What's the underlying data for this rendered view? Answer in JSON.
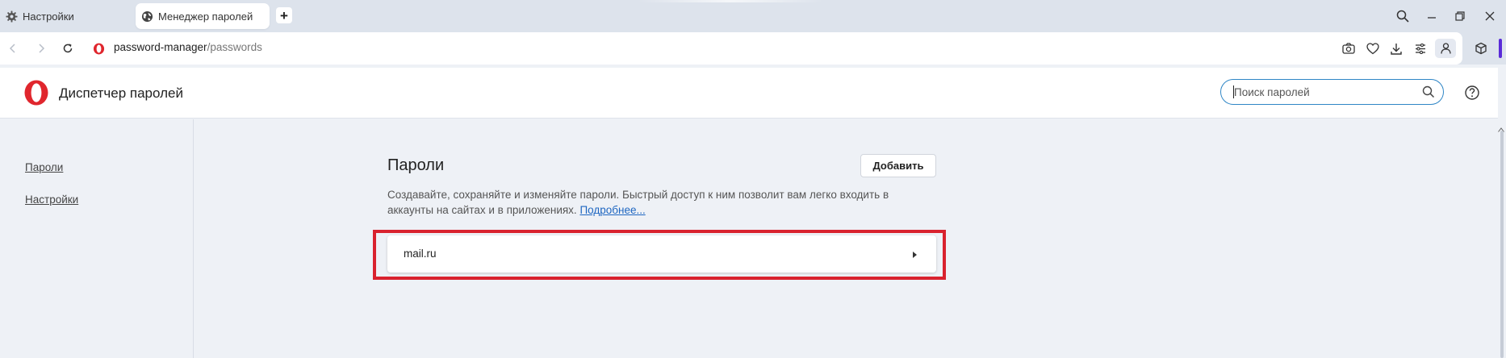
{
  "tabs": [
    {
      "label": "Настройки",
      "icon": "gear-icon",
      "active": false
    },
    {
      "label": "Менеджер паролей",
      "icon": "globe-icon",
      "active": true
    }
  ],
  "window_controls": [
    "search-tabs-icon",
    "minimize-icon",
    "restore-icon",
    "close-icon"
  ],
  "address_bar": {
    "host": "password-manager",
    "path": "/passwords"
  },
  "toolbar_icons": [
    "camera-icon",
    "heart-icon",
    "download-icon",
    "easy-setup-icon",
    "profile-icon",
    "extensions-icon"
  ],
  "header": {
    "title": "Диспетчер паролей",
    "search_placeholder": "Поиск паролей"
  },
  "sidebar": {
    "items": [
      {
        "label": "Пароли"
      },
      {
        "label": "Настройки"
      }
    ]
  },
  "main": {
    "title": "Пароли",
    "add_label": "Добавить",
    "description": "Создавайте, сохраняйте и изменяйте пароли. Быстрый доступ к ним позволит вам легко входить в аккаунты на сайтах и в приложениях.",
    "more_link": "Подробнее...",
    "entries": [
      {
        "site": "mail.ru"
      }
    ]
  },
  "colors": {
    "brand_red": "#e0262d",
    "highlight": "#d9222e",
    "link": "#1e66c1",
    "focus_ring": "#2f86c6",
    "accent_purple": "#5a2bd8"
  }
}
